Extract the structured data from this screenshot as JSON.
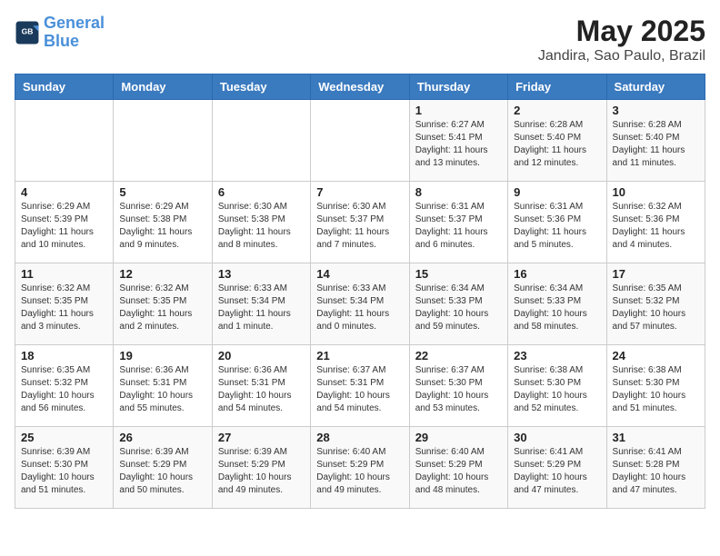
{
  "logo": {
    "line1": "General",
    "line2": "Blue"
  },
  "title": "May 2025",
  "subtitle": "Jandira, Sao Paulo, Brazil",
  "weekdays": [
    "Sunday",
    "Monday",
    "Tuesday",
    "Wednesday",
    "Thursday",
    "Friday",
    "Saturday"
  ],
  "weeks": [
    [
      {
        "day": "",
        "info": ""
      },
      {
        "day": "",
        "info": ""
      },
      {
        "day": "",
        "info": ""
      },
      {
        "day": "",
        "info": ""
      },
      {
        "day": "1",
        "info": "Sunrise: 6:27 AM\nSunset: 5:41 PM\nDaylight: 11 hours\nand 13 minutes."
      },
      {
        "day": "2",
        "info": "Sunrise: 6:28 AM\nSunset: 5:40 PM\nDaylight: 11 hours\nand 12 minutes."
      },
      {
        "day": "3",
        "info": "Sunrise: 6:28 AM\nSunset: 5:40 PM\nDaylight: 11 hours\nand 11 minutes."
      }
    ],
    [
      {
        "day": "4",
        "info": "Sunrise: 6:29 AM\nSunset: 5:39 PM\nDaylight: 11 hours\nand 10 minutes."
      },
      {
        "day": "5",
        "info": "Sunrise: 6:29 AM\nSunset: 5:38 PM\nDaylight: 11 hours\nand 9 minutes."
      },
      {
        "day": "6",
        "info": "Sunrise: 6:30 AM\nSunset: 5:38 PM\nDaylight: 11 hours\nand 8 minutes."
      },
      {
        "day": "7",
        "info": "Sunrise: 6:30 AM\nSunset: 5:37 PM\nDaylight: 11 hours\nand 7 minutes."
      },
      {
        "day": "8",
        "info": "Sunrise: 6:31 AM\nSunset: 5:37 PM\nDaylight: 11 hours\nand 6 minutes."
      },
      {
        "day": "9",
        "info": "Sunrise: 6:31 AM\nSunset: 5:36 PM\nDaylight: 11 hours\nand 5 minutes."
      },
      {
        "day": "10",
        "info": "Sunrise: 6:32 AM\nSunset: 5:36 PM\nDaylight: 11 hours\nand 4 minutes."
      }
    ],
    [
      {
        "day": "11",
        "info": "Sunrise: 6:32 AM\nSunset: 5:35 PM\nDaylight: 11 hours\nand 3 minutes."
      },
      {
        "day": "12",
        "info": "Sunrise: 6:32 AM\nSunset: 5:35 PM\nDaylight: 11 hours\nand 2 minutes."
      },
      {
        "day": "13",
        "info": "Sunrise: 6:33 AM\nSunset: 5:34 PM\nDaylight: 11 hours\nand 1 minute."
      },
      {
        "day": "14",
        "info": "Sunrise: 6:33 AM\nSunset: 5:34 PM\nDaylight: 11 hours\nand 0 minutes."
      },
      {
        "day": "15",
        "info": "Sunrise: 6:34 AM\nSunset: 5:33 PM\nDaylight: 10 hours\nand 59 minutes."
      },
      {
        "day": "16",
        "info": "Sunrise: 6:34 AM\nSunset: 5:33 PM\nDaylight: 10 hours\nand 58 minutes."
      },
      {
        "day": "17",
        "info": "Sunrise: 6:35 AM\nSunset: 5:32 PM\nDaylight: 10 hours\nand 57 minutes."
      }
    ],
    [
      {
        "day": "18",
        "info": "Sunrise: 6:35 AM\nSunset: 5:32 PM\nDaylight: 10 hours\nand 56 minutes."
      },
      {
        "day": "19",
        "info": "Sunrise: 6:36 AM\nSunset: 5:31 PM\nDaylight: 10 hours\nand 55 minutes."
      },
      {
        "day": "20",
        "info": "Sunrise: 6:36 AM\nSunset: 5:31 PM\nDaylight: 10 hours\nand 54 minutes."
      },
      {
        "day": "21",
        "info": "Sunrise: 6:37 AM\nSunset: 5:31 PM\nDaylight: 10 hours\nand 54 minutes."
      },
      {
        "day": "22",
        "info": "Sunrise: 6:37 AM\nSunset: 5:30 PM\nDaylight: 10 hours\nand 53 minutes."
      },
      {
        "day": "23",
        "info": "Sunrise: 6:38 AM\nSunset: 5:30 PM\nDaylight: 10 hours\nand 52 minutes."
      },
      {
        "day": "24",
        "info": "Sunrise: 6:38 AM\nSunset: 5:30 PM\nDaylight: 10 hours\nand 51 minutes."
      }
    ],
    [
      {
        "day": "25",
        "info": "Sunrise: 6:39 AM\nSunset: 5:30 PM\nDaylight: 10 hours\nand 51 minutes."
      },
      {
        "day": "26",
        "info": "Sunrise: 6:39 AM\nSunset: 5:29 PM\nDaylight: 10 hours\nand 50 minutes."
      },
      {
        "day": "27",
        "info": "Sunrise: 6:39 AM\nSunset: 5:29 PM\nDaylight: 10 hours\nand 49 minutes."
      },
      {
        "day": "28",
        "info": "Sunrise: 6:40 AM\nSunset: 5:29 PM\nDaylight: 10 hours\nand 49 minutes."
      },
      {
        "day": "29",
        "info": "Sunrise: 6:40 AM\nSunset: 5:29 PM\nDaylight: 10 hours\nand 48 minutes."
      },
      {
        "day": "30",
        "info": "Sunrise: 6:41 AM\nSunset: 5:29 PM\nDaylight: 10 hours\nand 47 minutes."
      },
      {
        "day": "31",
        "info": "Sunrise: 6:41 AM\nSunset: 5:28 PM\nDaylight: 10 hours\nand 47 minutes."
      }
    ]
  ]
}
